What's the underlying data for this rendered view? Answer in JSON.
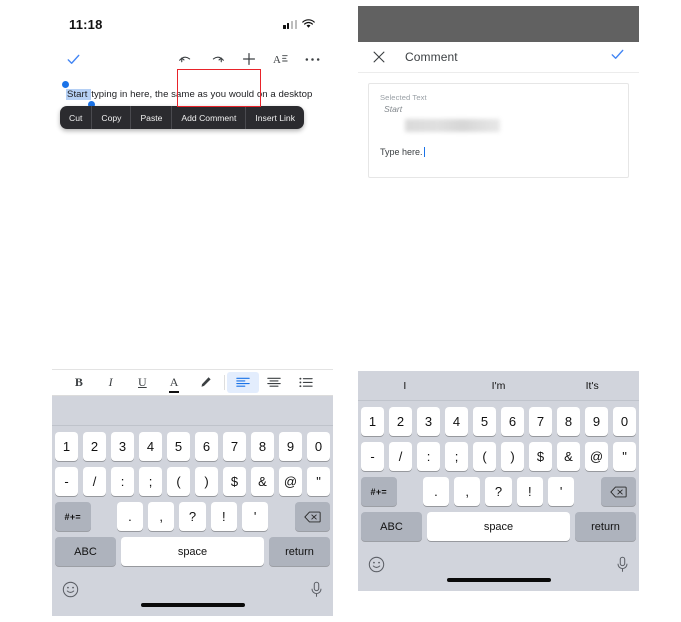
{
  "left_phone": {
    "status": {
      "time": "11:18",
      "signal_icon": "cellular-signal-icon",
      "wifi_icon": "wifi-icon"
    },
    "toolbar": {
      "done_label": "✓",
      "undo_label": "undo-icon",
      "redo_label": "redo-icon",
      "add_label": "+",
      "format_label": "A",
      "more_label": "•••"
    },
    "document": {
      "text_before": "",
      "selected_word": "Start",
      "text_after": " typing in here, the same as you would on a desktop version of Google Docs."
    },
    "context_menu": {
      "items": [
        "Cut",
        "Copy",
        "Paste",
        "Add Comment",
        "Insert Link"
      ],
      "highlighted_item": "Add Comment",
      "highlight_color": "#e8232a"
    },
    "format_bar": {
      "items": [
        {
          "name": "bold",
          "label": "B"
        },
        {
          "name": "italic",
          "label": "I"
        },
        {
          "name": "underline",
          "label": "U"
        },
        {
          "name": "text-color",
          "label": "A"
        },
        {
          "name": "highlight",
          "label": "highlighter-icon"
        },
        {
          "name": "align-left",
          "label": "align-left-icon"
        },
        {
          "name": "align-center",
          "label": "align-center-icon"
        },
        {
          "name": "bulleted-list",
          "label": "list-icon"
        }
      ],
      "active": "align-left"
    },
    "keyboard": {
      "suggestions": [
        "",
        "",
        ""
      ],
      "row_numbers": [
        "1",
        "2",
        "3",
        "4",
        "5",
        "6",
        "7",
        "8",
        "9",
        "0"
      ],
      "row_symbols": [
        "-",
        "/",
        ":",
        ";",
        "(",
        ")",
        "$",
        "&",
        "@",
        "\""
      ],
      "row_punct": [
        ".",
        ",",
        "?",
        "!",
        "'"
      ],
      "symbol_switch": "#+=",
      "backspace": "backspace-icon",
      "abc": "ABC",
      "space": "space",
      "return": "return",
      "emoji": "emoji-icon",
      "mic": "microphone-icon"
    }
  },
  "right_phone": {
    "status": {
      "redacted": true
    },
    "header": {
      "close_label": "✕",
      "title": "Comment",
      "confirm_label": "✓"
    },
    "comment_card": {
      "selected_text_label": "Selected Text",
      "selected_text_value": "Start",
      "redacted_line": true,
      "input_value": "Type here."
    },
    "keyboard": {
      "suggestions": [
        "I",
        "I'm",
        "It's"
      ],
      "row_numbers": [
        "1",
        "2",
        "3",
        "4",
        "5",
        "6",
        "7",
        "8",
        "9",
        "0"
      ],
      "row_symbols": [
        "-",
        "/",
        ":",
        ";",
        "(",
        ")",
        "$",
        "&",
        "@",
        "\""
      ],
      "row_punct": [
        ".",
        ",",
        "?",
        "!",
        "'"
      ],
      "symbol_switch": "#+=",
      "backspace": "backspace-icon",
      "abc": "ABC",
      "space": "space",
      "return": "return",
      "emoji": "emoji-icon",
      "mic": "microphone-icon"
    }
  },
  "colors": {
    "accent_blue": "#4285f4",
    "selection_blue": "#b5d0f5",
    "highlight_red": "#e8232a",
    "keyboard_bg": "#d1d4dc",
    "context_menu_bg": "#2b2b2f"
  }
}
